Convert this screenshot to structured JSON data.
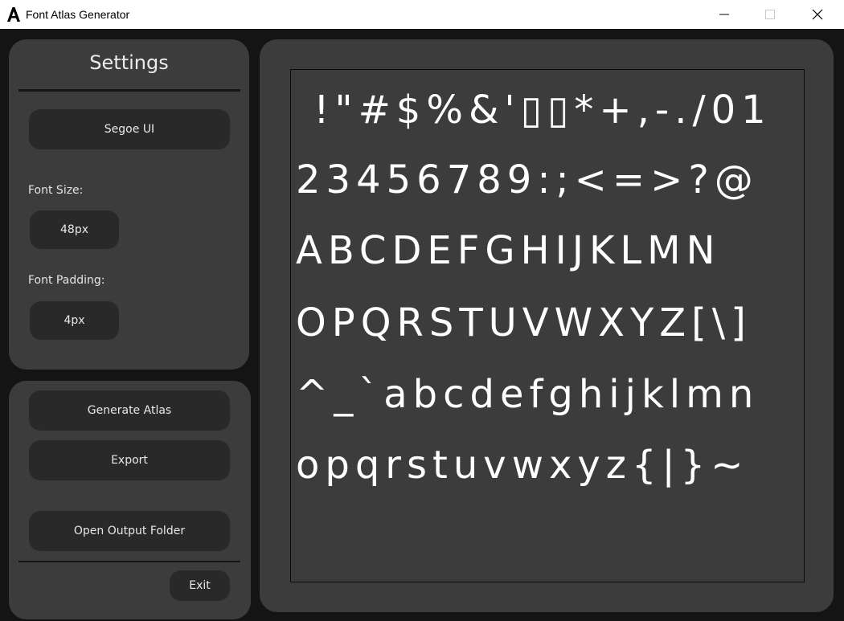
{
  "window": {
    "title": "Font Atlas Generator"
  },
  "settings": {
    "heading": "Settings",
    "font_name": "Segoe UI",
    "font_size_label": "Font Size:",
    "font_size_value": "48px",
    "font_padding_label": "Font Padding:",
    "font_padding_value": "4px"
  },
  "actions": {
    "generate_label": "Generate Atlas",
    "export_label": "Export",
    "open_folder_label": "Open Output Folder",
    "exit_label": "Exit"
  },
  "atlas": {
    "rows": [
      " !\"#$%&'▯▯*+,-./01",
      "23456789:;<=>?@",
      "ABCDEFGHIJKLMN",
      "OPQRSTUVWXYZ[\\]",
      "^_`abcdefghijklmn",
      "opqrstuvwxyz{|}~"
    ]
  },
  "colors": {
    "background": "#161616",
    "panel": "#3c3c3c",
    "button": "#292929",
    "text": "#e8e8e8"
  }
}
